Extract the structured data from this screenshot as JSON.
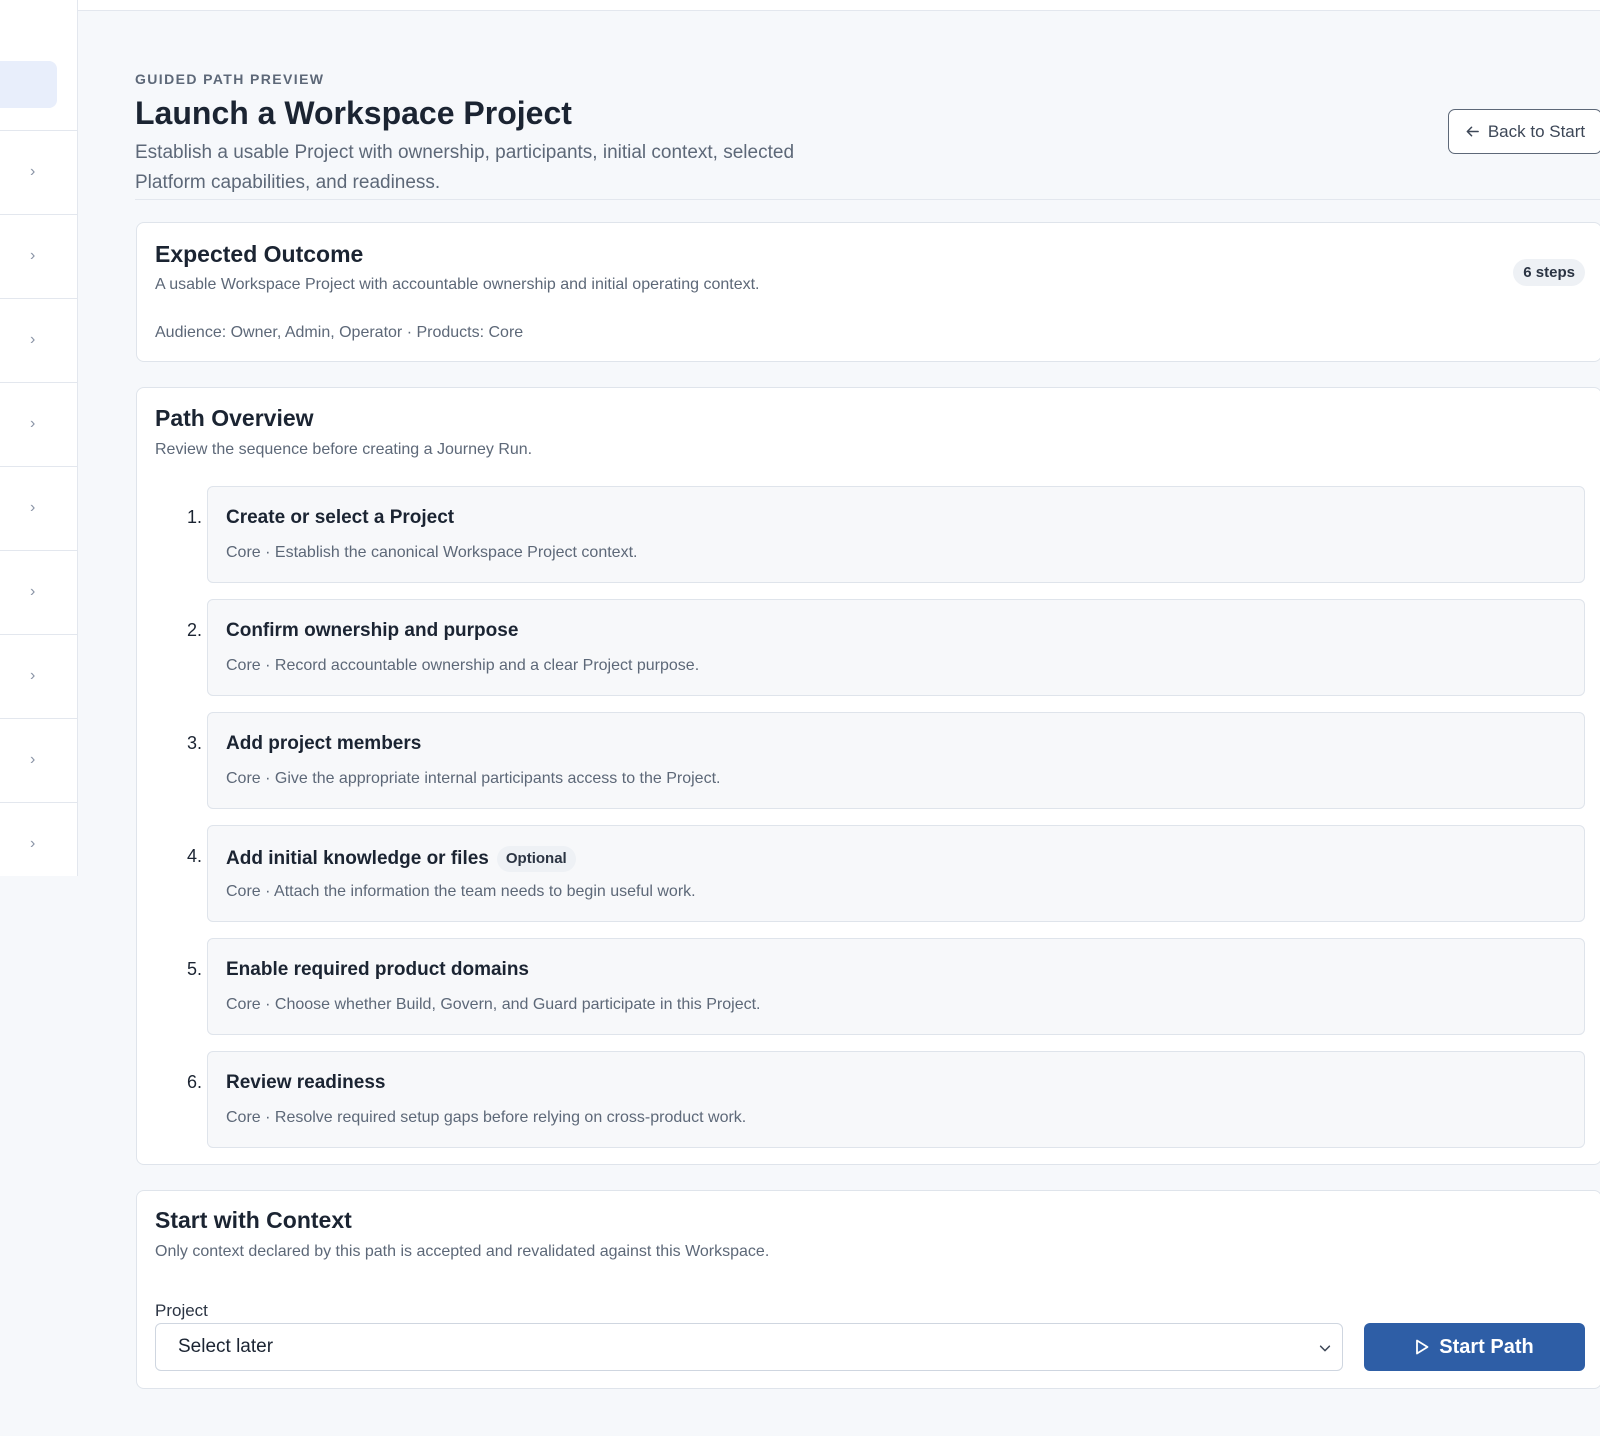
{
  "header": {
    "eyebrow": "GUIDED PATH PREVIEW",
    "title": "Launch a Workspace Project",
    "description": "Establish a usable Project with ownership, participants, initial context, selected Platform capabilities, and readiness.",
    "back_label": "Back to Start"
  },
  "outcome": {
    "title": "Expected Outcome",
    "description": "A usable Workspace Project with accountable ownership and initial operating context.",
    "meta": "Audience: Owner, Admin, Operator · Products: Core",
    "badge": "6 steps"
  },
  "overview": {
    "title": "Path Overview",
    "subtitle": "Review the sequence before creating a Journey Run.",
    "steps": [
      {
        "num": "1.",
        "title": "Create or select a Project",
        "desc": "Core · Establish the canonical Workspace Project context.",
        "tag": ""
      },
      {
        "num": "2.",
        "title": "Confirm ownership and purpose",
        "desc": "Core · Record accountable ownership and a clear Project purpose.",
        "tag": ""
      },
      {
        "num": "3.",
        "title": "Add project members",
        "desc": "Core · Give the appropriate internal participants access to the Project.",
        "tag": ""
      },
      {
        "num": "4.",
        "title": "Add initial knowledge or files",
        "desc": "Core · Attach the information the team needs to begin useful work.",
        "tag": "Optional"
      },
      {
        "num": "5.",
        "title": "Enable required product domains",
        "desc": "Core · Choose whether Build, Govern, and Guard participate in this Project.",
        "tag": ""
      },
      {
        "num": "6.",
        "title": "Review readiness",
        "desc": "Core · Resolve required setup gaps before relying on cross-product work.",
        "tag": ""
      }
    ]
  },
  "context": {
    "title": "Start with Context",
    "subtitle": "Only context declared by this path is accepted and revalidated against this Workspace.",
    "field_label": "Project",
    "select_value": "Select later",
    "start_label": "Start Path"
  },
  "icons": {
    "back": "arrow-left-icon",
    "start": "play-icon",
    "sidebar_chevron": "chevron-right-icon",
    "select": "chevron-down-icon"
  },
  "colors": {
    "primary": "#2e5ea6",
    "background": "#f6f8fb",
    "sidebar_active": "#e8eefb"
  }
}
